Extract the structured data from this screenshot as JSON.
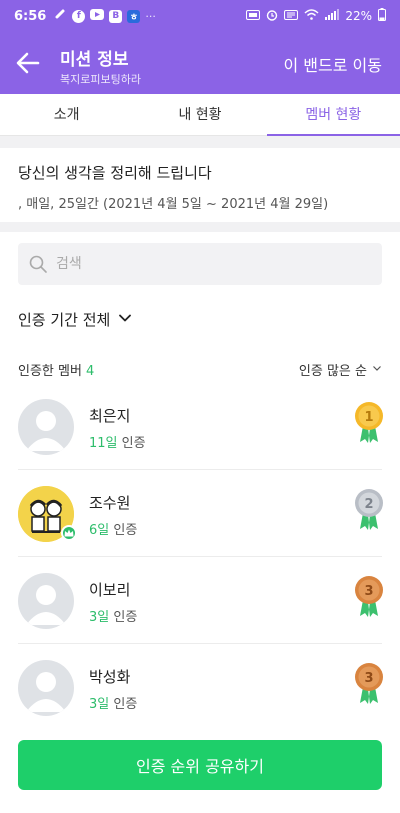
{
  "status_bar": {
    "time": "6:56",
    "left_icons": [
      "link-icon",
      "facebook-icon",
      "youtube-icon",
      "band-app-icon",
      "app-notification-icon"
    ],
    "more": "···",
    "battery": "22%"
  },
  "header": {
    "title": "미션 정보",
    "subtitle": "복지로피보팅하라",
    "move_label": "이 밴드로 이동"
  },
  "tabs": [
    {
      "label": "소개",
      "active": false
    },
    {
      "label": "내 현황",
      "active": false
    },
    {
      "label": "멤버 현황",
      "active": true
    }
  ],
  "mission": {
    "title": "당신의 생각을 정리해 드립니다",
    "description": ", 매일, 25일간 (2021년 4월 5일 ~ 2021년 4월 29일)"
  },
  "search": {
    "placeholder": "검색",
    "value": ""
  },
  "period_filter": "인증 기간 전체",
  "members_header": {
    "label": "인증한 멤버",
    "count": "4",
    "sort_label": "인증 많은 순"
  },
  "members": [
    {
      "name": "최은지",
      "days": "11일",
      "suffix": "인증",
      "rank": "1",
      "medal": "gold",
      "avatar": "default"
    },
    {
      "name": "조수원",
      "days": "6일",
      "suffix": "인증",
      "rank": "2",
      "medal": "silver",
      "avatar": "photo",
      "leader": true
    },
    {
      "name": "이보리",
      "days": "3일",
      "suffix": "인증",
      "rank": "3",
      "medal": "bronze",
      "avatar": "default"
    },
    {
      "name": "박성화",
      "days": "3일",
      "suffix": "인증",
      "rank": "3",
      "medal": "bronze",
      "avatar": "default"
    }
  ],
  "share_button": "인증 순위 공유하기",
  "colors": {
    "accent": "#8b63e6",
    "green": "#2dbd6b",
    "button": "#1ecf6a",
    "gold": "#f5b829",
    "silver": "#b9bec6",
    "bronze": "#d9843f"
  }
}
